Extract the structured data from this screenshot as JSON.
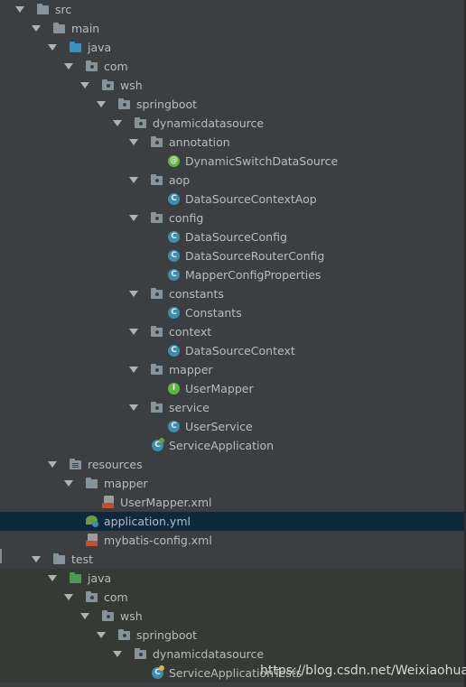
{
  "project_tree": {
    "watermark": "https://blog.csdn.net/Weixiaohuai",
    "colors": {
      "background": "#3c3f41",
      "selected_row": "#0d293e",
      "test_area": "#363a34",
      "text": "#bbbbbb",
      "java_source_folder": "#3592c4",
      "test_source_folder": "#499c54",
      "class_badge": "#3d8dae",
      "annotation_badge": "#62b543",
      "interface_badge": "#62b543"
    },
    "rows": [
      {
        "label": "src",
        "icon": "folder-icon",
        "depth": 0,
        "expanded": true
      },
      {
        "label": "main",
        "icon": "folder-icon",
        "depth": 1,
        "expanded": true
      },
      {
        "label": "java",
        "icon": "source-folder-icon",
        "depth": 2,
        "expanded": true
      },
      {
        "label": "com",
        "icon": "package-icon",
        "depth": 3,
        "expanded": true
      },
      {
        "label": "wsh",
        "icon": "package-icon",
        "depth": 4,
        "expanded": true
      },
      {
        "label": "springboot",
        "icon": "package-icon",
        "depth": 5,
        "expanded": true
      },
      {
        "label": "dynamicdatasource",
        "icon": "package-icon",
        "depth": 6,
        "expanded": true
      },
      {
        "label": "annotation",
        "icon": "package-icon",
        "depth": 7,
        "expanded": true
      },
      {
        "label": "DynamicSwitchDataSource",
        "icon": "annotation-icon",
        "depth": 8
      },
      {
        "label": "aop",
        "icon": "package-icon",
        "depth": 7,
        "expanded": true
      },
      {
        "label": "DataSourceContextAop",
        "icon": "class-icon",
        "depth": 8
      },
      {
        "label": "config",
        "icon": "package-icon",
        "depth": 7,
        "expanded": true
      },
      {
        "label": "DataSourceConfig",
        "icon": "class-icon",
        "depth": 8
      },
      {
        "label": "DataSourceRouterConfig",
        "icon": "class-icon",
        "depth": 8
      },
      {
        "label": "MapperConfigProperties",
        "icon": "class-icon",
        "depth": 8
      },
      {
        "label": "constants",
        "icon": "package-icon",
        "depth": 7,
        "expanded": true
      },
      {
        "label": "Constants",
        "icon": "class-icon",
        "depth": 8
      },
      {
        "label": "context",
        "icon": "package-icon",
        "depth": 7,
        "expanded": true
      },
      {
        "label": "DataSourceContext",
        "icon": "class-icon",
        "depth": 8
      },
      {
        "label": "mapper",
        "icon": "package-icon",
        "depth": 7,
        "expanded": true
      },
      {
        "label": "UserMapper",
        "icon": "interface-icon",
        "depth": 8
      },
      {
        "label": "service",
        "icon": "package-icon",
        "depth": 7,
        "expanded": true
      },
      {
        "label": "UserService",
        "icon": "class-icon",
        "depth": 8
      },
      {
        "label": "ServiceApplication",
        "icon": "spring-boot-class-icon",
        "depth": 7
      },
      {
        "label": "resources",
        "icon": "resources-folder-icon",
        "depth": 2,
        "expanded": true
      },
      {
        "label": "mapper",
        "icon": "folder-icon",
        "depth": 3,
        "expanded": true
      },
      {
        "label": "UserMapper.xml",
        "icon": "xml-file-icon",
        "depth": 4
      },
      {
        "label": "application.yml",
        "icon": "yaml-file-icon",
        "depth": 3,
        "selected": true
      },
      {
        "label": "mybatis-config.xml",
        "icon": "xml-file-icon",
        "depth": 3
      },
      {
        "label": "test",
        "icon": "folder-icon",
        "depth": 1,
        "expanded": true
      },
      {
        "label": "java",
        "icon": "test-source-folder-icon",
        "depth": 2,
        "expanded": true,
        "test_area": true
      },
      {
        "label": "com",
        "icon": "package-icon",
        "depth": 3,
        "expanded": true,
        "test_area": true
      },
      {
        "label": "wsh",
        "icon": "package-icon",
        "depth": 4,
        "expanded": true,
        "test_area": true
      },
      {
        "label": "springboot",
        "icon": "package-icon",
        "depth": 5,
        "expanded": true,
        "test_area": true
      },
      {
        "label": "dynamicdatasource",
        "icon": "package-icon",
        "depth": 6,
        "expanded": true,
        "test_area": true
      },
      {
        "label": "ServiceApplicationTests",
        "icon": "test-class-icon",
        "depth": 7,
        "test_area": true
      }
    ]
  }
}
